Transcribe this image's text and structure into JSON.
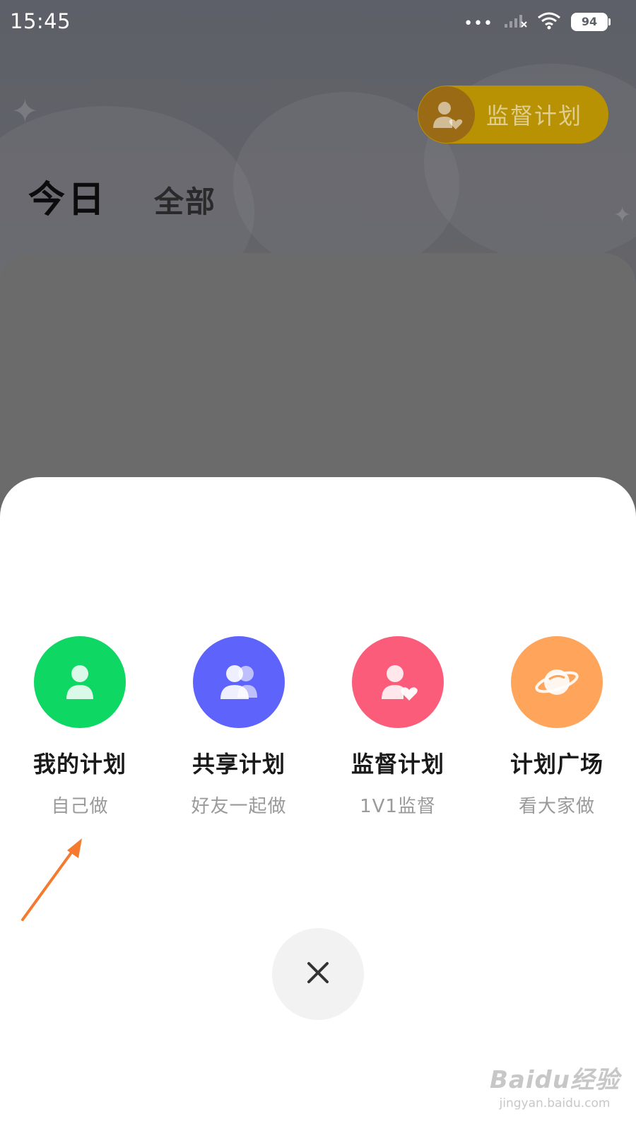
{
  "status_bar": {
    "time": "15:45",
    "dots": "•••",
    "battery": "94"
  },
  "header": {
    "supervise_button_label": "监督计划"
  },
  "tabs": {
    "today": "今日",
    "all": "全部"
  },
  "sheet": {
    "options": [
      {
        "title": "我的计划",
        "subtitle": "自己做",
        "color": "#0ed763",
        "icon": "person-icon"
      },
      {
        "title": "共享计划",
        "subtitle": "好友一起做",
        "color": "#5e63fb",
        "icon": "people-icon"
      },
      {
        "title": "监督计划",
        "subtitle": "1V1监督",
        "color": "#fb5c7a",
        "icon": "person-heart-icon"
      },
      {
        "title": "计划广场",
        "subtitle": "看大家做",
        "color": "#ffa45b",
        "icon": "planet-icon"
      }
    ],
    "close_icon": "close-icon"
  },
  "annotation": {
    "arrow_color": "#f57a2e"
  },
  "watermark": {
    "brand": "Baidu经验",
    "url": "jingyan.baidu.com"
  }
}
